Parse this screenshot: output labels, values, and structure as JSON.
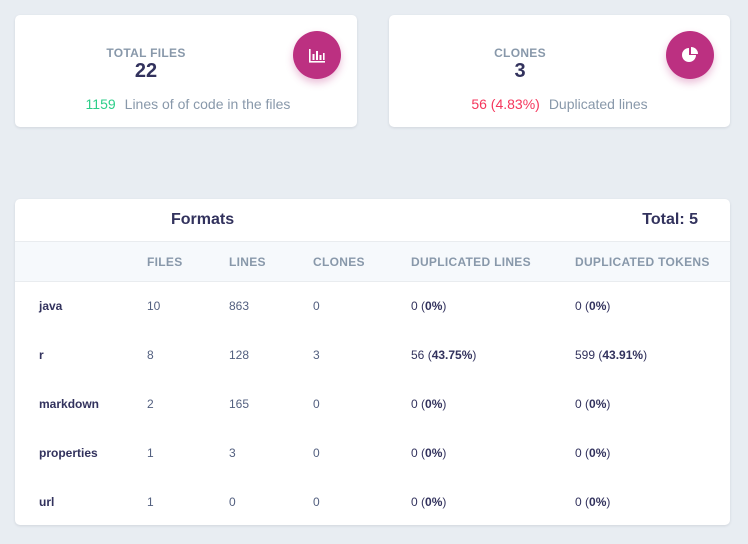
{
  "colors": {
    "accent": "#bc3081",
    "green": "#2dce89",
    "red": "#f5365c",
    "muted": "#8898aa",
    "heading": "#32325d",
    "background": "#e8edf2"
  },
  "files_card": {
    "title": "TOTAL FILES",
    "value": "22",
    "icon": "bar-chart-icon",
    "foot_number": "1159",
    "foot_text": "Lines of of code in the files"
  },
  "clones_card": {
    "title": "CLONES",
    "value": "3",
    "icon": "pie-chart-icon",
    "foot_number": "56 (4.83%)",
    "foot_text": "Duplicated lines"
  },
  "formats": {
    "title": "Formats",
    "total": "Total: 5",
    "columns": [
      "",
      "FILES",
      "LINES",
      "CLONES",
      "DUPLICATED LINES",
      "DUPLICATED TOKENS"
    ],
    "rows": [
      {
        "format": "java",
        "files": "10",
        "lines": "863",
        "clones": "0",
        "dup_lines": "0",
        "dup_lines_pct": "0%",
        "dup_tokens": "0",
        "dup_tokens_pct": "0%"
      },
      {
        "format": "r",
        "files": "8",
        "lines": "128",
        "clones": "3",
        "dup_lines": "56",
        "dup_lines_pct": "43.75%",
        "dup_tokens": "599",
        "dup_tokens_pct": "43.91%"
      },
      {
        "format": "markdown",
        "files": "2",
        "lines": "165",
        "clones": "0",
        "dup_lines": "0",
        "dup_lines_pct": "0%",
        "dup_tokens": "0",
        "dup_tokens_pct": "0%"
      },
      {
        "format": "properties",
        "files": "1",
        "lines": "3",
        "clones": "0",
        "dup_lines": "0",
        "dup_lines_pct": "0%",
        "dup_tokens": "0",
        "dup_tokens_pct": "0%"
      },
      {
        "format": "url",
        "files": "1",
        "lines": "0",
        "clones": "0",
        "dup_lines": "0",
        "dup_lines_pct": "0%",
        "dup_tokens": "0",
        "dup_tokens_pct": "0%"
      }
    ]
  }
}
